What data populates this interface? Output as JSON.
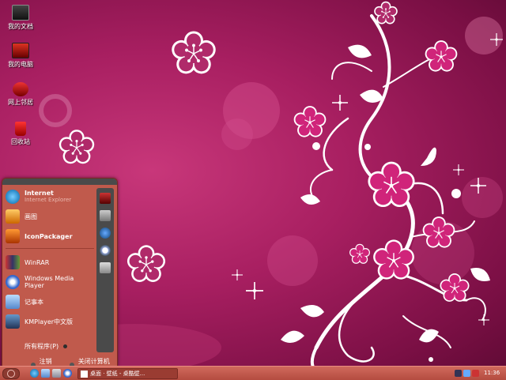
{
  "desktop": {
    "icons": [
      {
        "label": "我的文档",
        "icon": "folder-icon"
      },
      {
        "label": "我的电脑",
        "icon": "computer-icon"
      },
      {
        "label": "网上邻居",
        "icon": "network-icon"
      },
      {
        "label": "回收站",
        "icon": "recycle-bin-icon"
      }
    ]
  },
  "start_menu": {
    "pinned": [
      {
        "title": "Internet",
        "subtitle": "Internet Explorer",
        "icon": "ie-icon"
      },
      {
        "title": "画图",
        "subtitle": "",
        "icon": "paint-icon"
      },
      {
        "title": "IconPackager",
        "subtitle": "",
        "icon": "iconpackager-icon"
      }
    ],
    "recent": [
      {
        "title": "WinRAR",
        "icon": "winrar-icon"
      },
      {
        "title": "Windows Media Player",
        "icon": "media-player-icon"
      },
      {
        "title": "记事本",
        "icon": "notepad-icon"
      },
      {
        "title": "KMPlayer中文版",
        "icon": "kmplayer-icon"
      }
    ],
    "all_programs": "所有程序(P)",
    "logoff": "注销(L)",
    "shutdown": "关闭计算机(U)"
  },
  "taskbar": {
    "task_label": "桌面 · 壁纸 - 桌酷壁...",
    "clock": "11:36"
  },
  "colors": {
    "wallpaper": "#a81f61",
    "menu": "#c05a4c",
    "panel": "#4a4a4a",
    "taskbar": "#c05a4c"
  }
}
